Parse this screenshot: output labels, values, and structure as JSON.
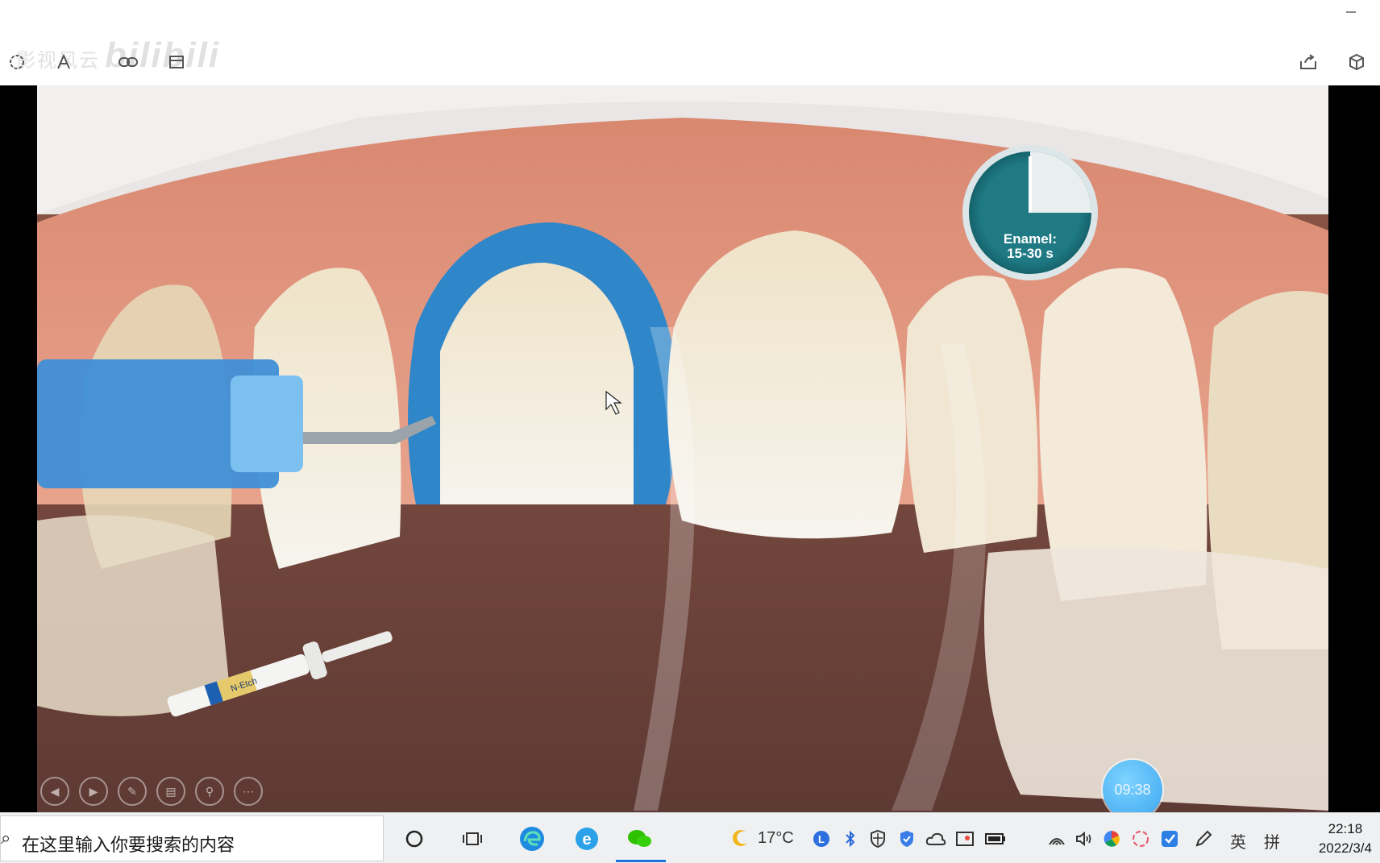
{
  "watermark": {
    "site_text": "bilibili",
    "cn_text": "影视风云"
  },
  "toolbar": {
    "lasso_icon": "lasso-icon",
    "text_icon": "text-icon",
    "link_icon": "link-icon",
    "crop_icon": "crop-icon",
    "share_icon": "share-icon",
    "cube_icon": "cube-icon"
  },
  "slide": {
    "clock_label_line1": "Enamel:",
    "clock_label_line2": "15-30 s",
    "syringe_label": "N-Etch",
    "timer": "09:38"
  },
  "slide_controls": [
    "previous",
    "next",
    "pen",
    "slides",
    "zoom",
    "more"
  ],
  "taskbar": {
    "search_placeholder": "在这里输入你要搜索的内容",
    "weather": "17°C",
    "ime_lang": "英",
    "ime_mode": "拼",
    "time": "22:18",
    "date": "2022/3/4"
  },
  "colors": {
    "gel": "#2f86c9",
    "taskbar_bg": "#eef0f2",
    "active_indicator": "#1a73d9"
  }
}
